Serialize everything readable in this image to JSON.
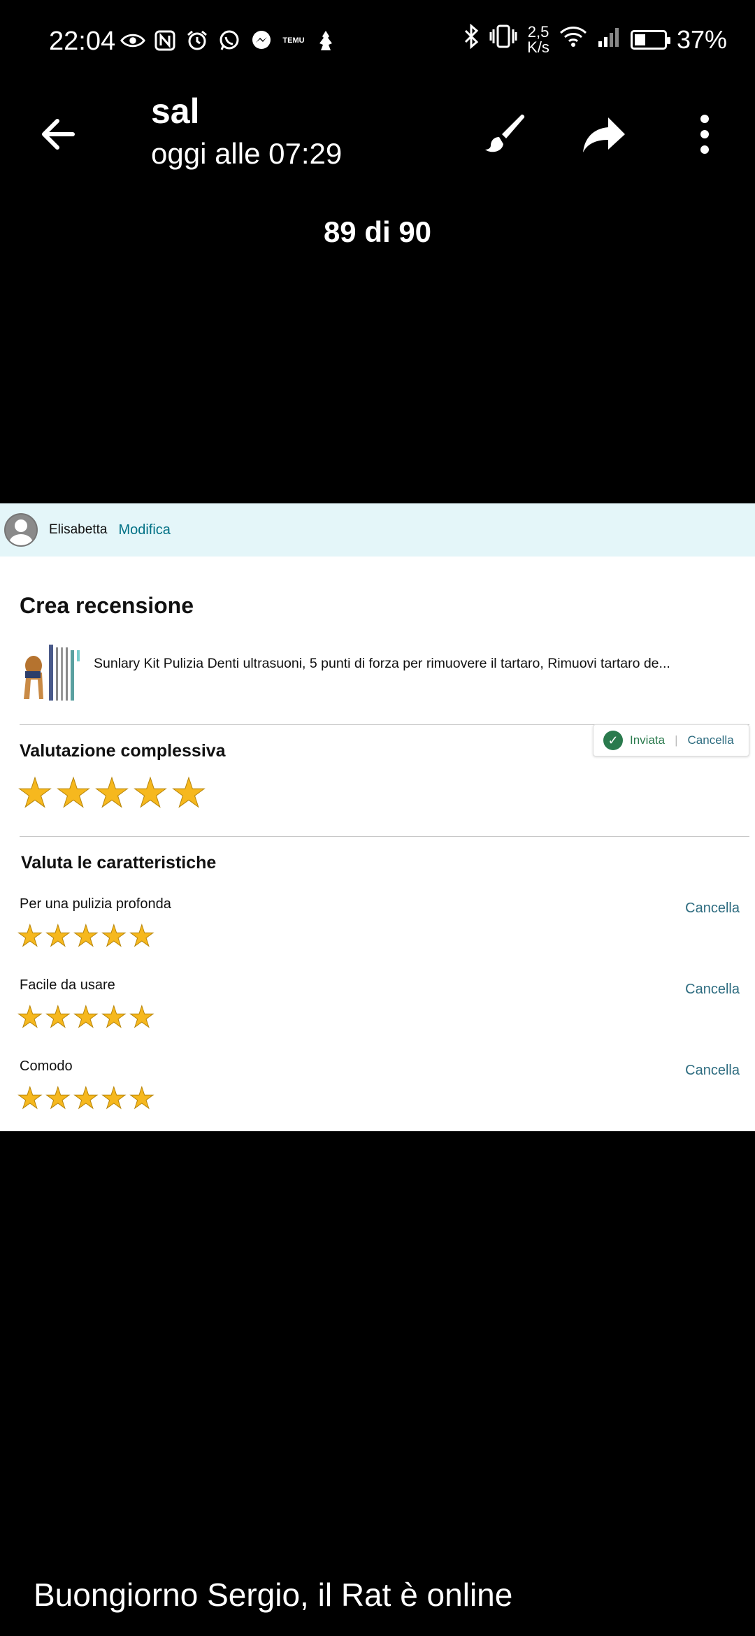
{
  "status_bar": {
    "time": "22:04",
    "speed_value": "2,5",
    "speed_unit": "K/s",
    "battery": "37%",
    "battery_level": 0.37,
    "icons_left": [
      "eye-icon",
      "nfc-icon",
      "alarm-icon",
      "whatsapp-icon",
      "messenger-icon",
      "temu-icon",
      "app-icon"
    ],
    "temu_text": "TEMU"
  },
  "app_bar": {
    "title": "sal",
    "subtitle": "oggi alle 07:29",
    "counter": "89 di 90"
  },
  "review": {
    "user_name": "Elisabetta",
    "edit_label": "Modifica",
    "heading": "Crea recensione",
    "product_title": "Sunlary Kit Pulizia Denti ultrasuoni, 5 punti di forza per rimuovere il tartaro, Rimuovi tartaro de...",
    "sent_label": "Inviata",
    "sent_cancel": "Cancella",
    "overall_label": "Valutazione complessiva",
    "overall_rating": 5,
    "features_label": "Valuta le caratteristiche",
    "features": [
      {
        "label": "Per una pulizia profonda",
        "rating": 5,
        "cancel": "Cancella"
      },
      {
        "label": "Facile da usare",
        "rating": 5,
        "cancel": "Cancella"
      },
      {
        "label": "Comodo",
        "rating": 5,
        "cancel": "Cancella"
      }
    ]
  },
  "caption": "Buongiorno Sergio, il Rat è online",
  "colors": {
    "star": "#f6b81e",
    "link": "#007185",
    "header_bg": "#e4f6f9",
    "success": "#2a7a4d"
  }
}
